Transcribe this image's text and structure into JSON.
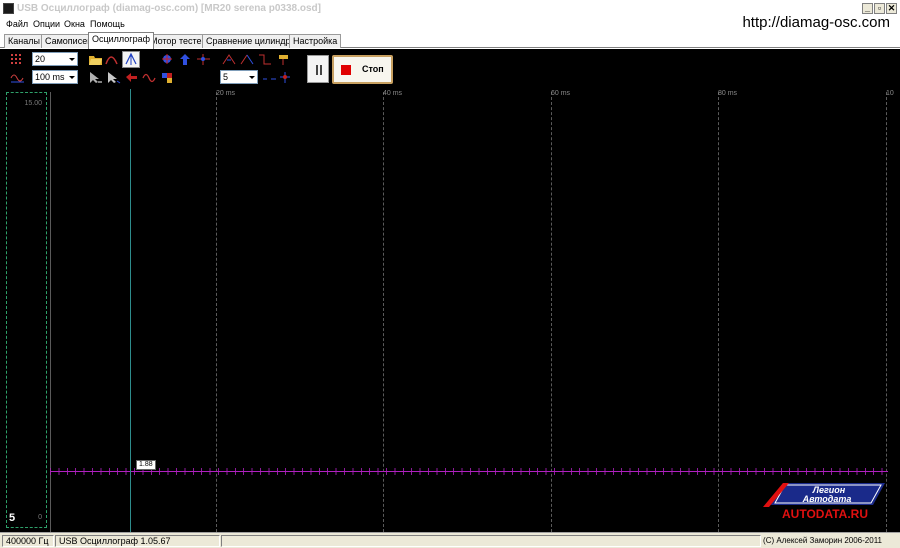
{
  "window": {
    "title": "USB Осциллограф (diamag-osc.com) [MR20 serena p0338.osd]",
    "minimize_glyph": "_",
    "restore_glyph": "▫",
    "close_glyph": "✕"
  },
  "menu": {
    "items": [
      "Файл",
      "Опции",
      "Окна",
      "Помощь"
    ]
  },
  "url": "http://diamag-osc.com",
  "tabs": [
    "Каналы",
    "Самописец",
    "Осциллограф",
    "Мотор тестер",
    "Сравнение цилиндров",
    "Настройка"
  ],
  "active_tab": "Осциллограф",
  "toolbar": {
    "count_combo": "20",
    "timebase_combo": "100  ms",
    "level_combo": "5",
    "stop_label": "Стоп"
  },
  "plot": {
    "scale_top": "15.00",
    "scale_bottom": "0",
    "channel_number": "5",
    "time_labels": [
      "20 ms",
      "40 ms",
      "60 ms",
      "80 ms",
      "10"
    ],
    "cursor_value": "1.88"
  },
  "logo": {
    "line1": "Легион",
    "line2": "Автодата",
    "line3": "AUTODATA.RU"
  },
  "statusbar": {
    "frequency": "400000  Гц",
    "version": "USB Осциллограф 1.05.67",
    "copyright": "(C) Алексей Заморин 2006-2011"
  },
  "colors": {
    "background": "#000000",
    "trace": "#b020c0",
    "cursor": "#2e8c8c",
    "scale_border": "#2ea06a",
    "stop_icon": "#e00000",
    "logo_red": "#e01010",
    "logo_blue": "#1a2a8a"
  }
}
